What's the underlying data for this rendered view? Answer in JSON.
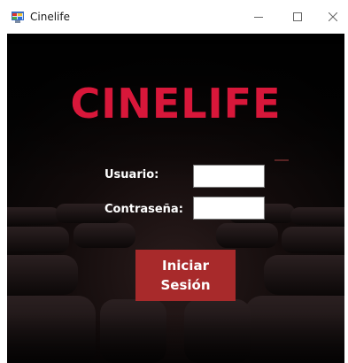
{
  "window": {
    "title": "Cinelife",
    "icon": "winforms-app-icon",
    "controls": [
      "minimize-icon",
      "maximize-icon",
      "close-icon"
    ]
  },
  "form": {
    "brand": "CINELIFE",
    "username_label": "Usuario:",
    "username_value": "",
    "password_label": "Contraseña:",
    "password_value": "",
    "login_line1": "Iniciar",
    "login_line2": "Sesión"
  },
  "colors": {
    "brand": "#d8173a",
    "button": "#a82a2b",
    "background": "#050505"
  }
}
